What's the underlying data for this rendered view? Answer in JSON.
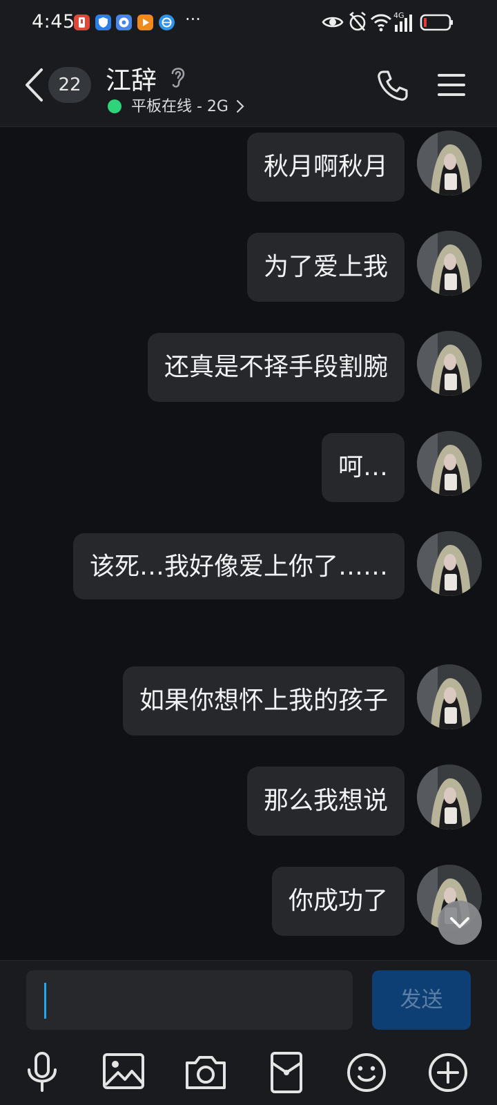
{
  "status_bar": {
    "time": "4:45",
    "more": "···",
    "battery_color": "#e23b3b",
    "network": "4G"
  },
  "header": {
    "unread_count": "22",
    "contact_name": "江辞",
    "online_status": "平板在线 - 2G"
  },
  "messages": [
    {
      "text": "秋月啊秋月",
      "from": "me"
    },
    {
      "text": "为了爱上我",
      "from": "me"
    },
    {
      "text": "还真是不择手段割腕",
      "from": "me"
    },
    {
      "text": "呵…",
      "from": "me"
    },
    {
      "text": "该死…我好像爱上你了……",
      "from": "me"
    },
    {
      "text": "如果你想怀上我的孩子",
      "from": "me"
    },
    {
      "text": "那么我想说",
      "from": "me"
    },
    {
      "text": "你成功了",
      "from": "me"
    }
  ],
  "composer": {
    "input_value": "",
    "send_label": "发送"
  },
  "toolbar": {
    "icons": [
      "microphone-icon",
      "image-icon",
      "camera-icon",
      "red-packet-icon",
      "emoji-icon",
      "plus-icon"
    ]
  },
  "colors": {
    "accent": "#1fa9f0",
    "online": "#2fd47a",
    "bubble": "#26282c",
    "send_button": "#0e3f74"
  }
}
